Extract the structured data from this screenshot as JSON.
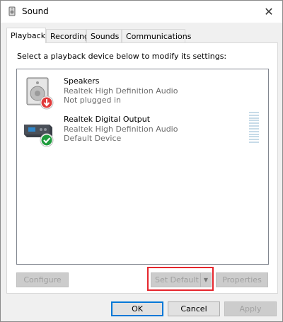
{
  "window": {
    "title": "Sound",
    "close_glyph": "✕"
  },
  "tabs": [
    {
      "label": "Playback",
      "active": true
    },
    {
      "label": "Recording",
      "active": false
    },
    {
      "label": "Sounds",
      "active": false
    },
    {
      "label": "Communications",
      "active": false
    }
  ],
  "panel": {
    "instruction": "Select a playback device below to modify its settings:"
  },
  "devices": [
    {
      "name": "Speakers",
      "driver": "Realtek High Definition Audio",
      "status": "Not plugged in",
      "icon": "speaker-icon",
      "badge": "red-down-arrow-badge"
    },
    {
      "name": "Realtek Digital Output",
      "driver": "Realtek High Definition Audio",
      "status": "Default Device",
      "icon": "digital-output-icon",
      "badge": "green-check-badge"
    }
  ],
  "buttons": {
    "configure": "Configure",
    "set_default": "Set Default",
    "properties": "Properties",
    "ok": "OK",
    "cancel": "Cancel",
    "apply": "Apply"
  },
  "colors": {
    "accent": "#0078d7",
    "highlight": "#e5262d",
    "meter": "#c7dbe8",
    "muted_text": "#6d6d6d"
  }
}
